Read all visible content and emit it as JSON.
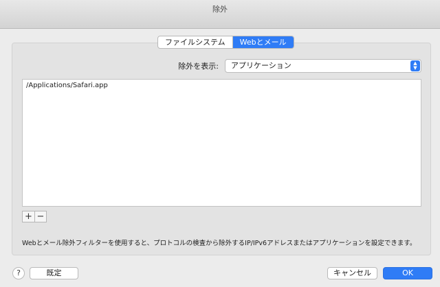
{
  "window": {
    "title": "除外"
  },
  "tabs": [
    {
      "label": "ファイルシステム",
      "active": false
    },
    {
      "label": "Webとメール",
      "active": true
    }
  ],
  "show_exclusions": {
    "label": "除外を表示:",
    "selected": "アプリケーション"
  },
  "exclusions_list": {
    "items": [
      "/Applications/Safari.app"
    ]
  },
  "list_controls": {
    "add": "+",
    "remove": "−"
  },
  "description": "Webとメール除外フィルターを使用すると、プロトコルの検査から除外するIP/IPv6アドレスまたはアプリケーションを設定できます。",
  "footer": {
    "help": "?",
    "default_label": "既定",
    "cancel_label": "キャンセル",
    "ok_label": "OK"
  },
  "colors": {
    "accent": "#2f7cf6"
  }
}
